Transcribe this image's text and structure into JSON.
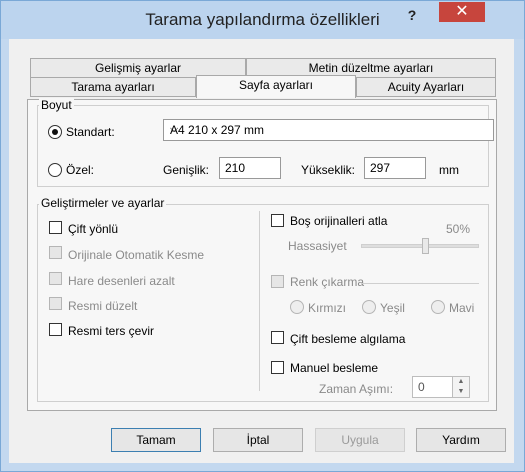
{
  "window": {
    "title": "Tarama yapılandırma özellikleri",
    "help": "?",
    "close": "✕"
  },
  "tabs_row1": [
    "Gelişmiş ayarlar",
    "Metin düzeltme ayarları"
  ],
  "tabs_row2": [
    "Tarama ayarları",
    "Sayfa ayarları",
    "Acuity Ayarları"
  ],
  "boyut": {
    "title": "Boyut",
    "standard_label": "Standart:",
    "standard_value": "A4 210 x 297 mm",
    "custom_label": "Özel:",
    "width_label": "Genişlik:",
    "width_value": "210",
    "height_label": "Yükseklik:",
    "height_value": "297",
    "unit": "mm"
  },
  "enh": {
    "title": "Geliştirmeler ve ayarlar",
    "left": [
      "Çift yönlü",
      "Orijinale Otomatik Kesme",
      "Hare desenleri azalt",
      "Resmi düzelt",
      "Resmi ters çevir"
    ],
    "skip_blank": "Boş orijinalleri atla",
    "sensitivity_label": "Hassasiyet",
    "sensitivity_value": "50%",
    "sensitivity_level": 0.5,
    "color_drop": "Renk çıkarma",
    "colors": [
      "Kırmızı",
      "Yeşil",
      "Mavi"
    ],
    "double_feed": "Çift besleme algılama",
    "manual_feed": "Manuel besleme",
    "timeout_label": "Zaman Aşımı:",
    "timeout_value": "0"
  },
  "buttons": {
    "ok": "Tamam",
    "cancel": "İptal",
    "apply": "Uygula",
    "help": "Yardım"
  }
}
